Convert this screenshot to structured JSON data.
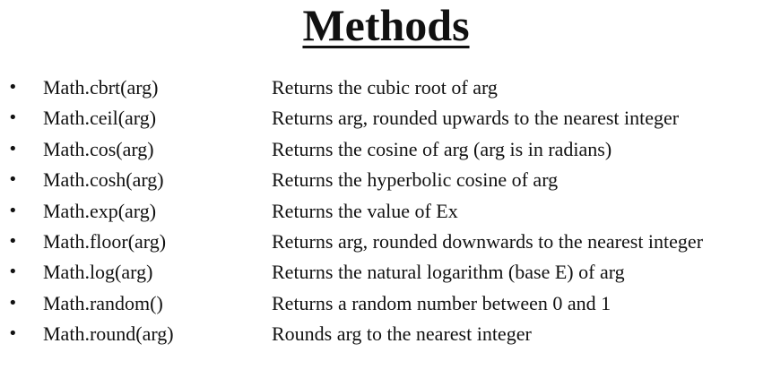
{
  "title": "Methods",
  "methods": [
    {
      "bullet": "•",
      "name": "Math.cbrt(arg)",
      "description": "Returns the cubic root of arg"
    },
    {
      "bullet": "•",
      "name": "Math.ceil(arg)",
      "description": "Returns arg, rounded upwards to the nearest integer"
    },
    {
      "bullet": "•",
      "name": "Math.cos(arg)",
      "description": "Returns the cosine of arg (arg is in radians)"
    },
    {
      "bullet": "•",
      "name": "Math.cosh(arg)",
      "description": "Returns the hyperbolic cosine of arg"
    },
    {
      "bullet": "•",
      "name": "Math.exp(arg)",
      "description": "Returns the value of Ex"
    },
    {
      "bullet": "•",
      "name": "Math.floor(arg)",
      "description": "Returns arg, rounded downwards to the nearest integer"
    },
    {
      "bullet": "•",
      "name": "Math.log(arg)",
      "description": "Returns the natural logarithm (base E) of arg"
    },
    {
      "bullet": "•",
      "name": "Math.random()",
      "description": "Returns a random number between 0 and 1"
    },
    {
      "bullet": "•",
      "name": "Math.round(arg)",
      "description": "Rounds arg to the nearest integer"
    }
  ]
}
